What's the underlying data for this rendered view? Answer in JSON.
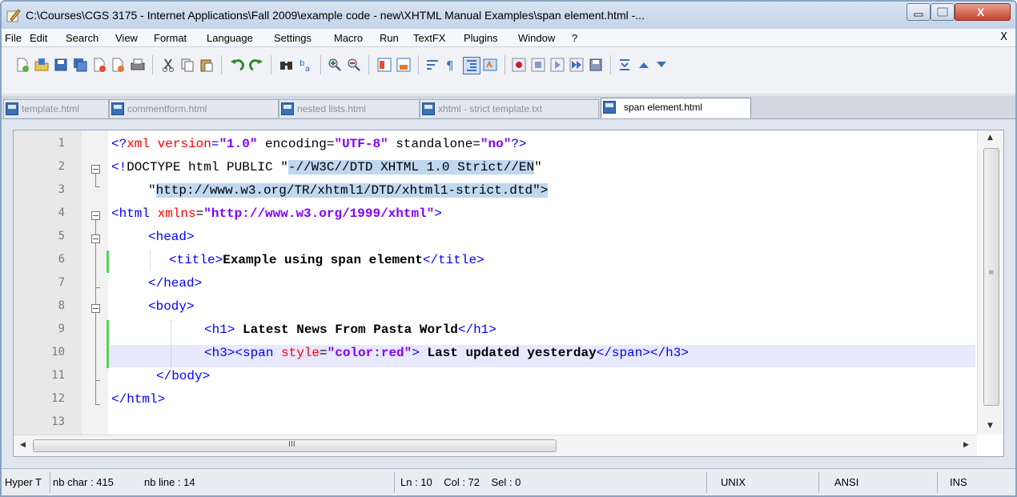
{
  "window": {
    "title": "C:\\Courses\\CGS 3175 - Internet Applications\\Fall 2009\\example code - new\\XHTML Manual Examples\\span element.html -...",
    "close_label": "X"
  },
  "menu": {
    "items": [
      "File",
      "Edit",
      "Search",
      "View",
      "Format",
      "Language",
      "Settings",
      "Macro",
      "Run",
      "TextFX",
      "Plugins",
      "Window",
      "?"
    ],
    "close_doc": "X"
  },
  "toolbar": {
    "icons": [
      "new-file-icon",
      "open-file-icon",
      "save-icon",
      "save-all-icon",
      "close-icon",
      "close-all-icon",
      "print-icon",
      "cut-icon",
      "copy-icon",
      "paste-icon",
      "undo-icon",
      "redo-icon",
      "find-icon",
      "replace-icon",
      "zoom-in-icon",
      "zoom-out-icon",
      "sync-vertical-icon",
      "sync-horizontal-icon",
      "word-wrap-icon",
      "show-all-chars-icon",
      "indent-guide-icon",
      "user-lang-icon",
      "record-macro-icon",
      "stop-macro-icon",
      "play-macro-icon",
      "run-macro-multiple-icon",
      "save-macro-icon",
      "collapse-icon",
      "move-up-icon",
      "move-down-icon"
    ]
  },
  "tabs": [
    {
      "label": "template.html",
      "active": false
    },
    {
      "label": "commentform.html",
      "active": false
    },
    {
      "label": "nested lists.html",
      "active": false
    },
    {
      "label": "xhtml - strict template.txt",
      "active": false
    },
    {
      "label": "span element.html",
      "active": true
    }
  ],
  "editor": {
    "line_numbers": [
      "1",
      "2",
      "3",
      "4",
      "5",
      "6",
      "7",
      "8",
      "9",
      "10",
      "11",
      "12",
      "13"
    ],
    "lines": {
      "l1": {
        "a": "<?",
        "b": "xml",
        "c": " version",
        "d": "=",
        "e": "\"1.0\"",
        "f": " encoding=",
        "g": "\"UTF-8\"",
        "h": " standalone=",
        "i": "\"no\"",
        "j": "?>"
      },
      "l2": {
        "a": "<!",
        "b": "DOCTYPE html PUBLIC ",
        "c": "\"",
        "d": "-//W3C//DTD XHTML 1.0 Strict//EN",
        "e": "\""
      },
      "l3": {
        "a": "\"",
        "b": "http://www.w3.org/TR/xhtml1/DTD/xhtml1-strict.dtd",
        "c": "\">"
      },
      "l4": {
        "a": "<html ",
        "b": "xmlns",
        "c": "=",
        "d": "\"http://www.w3.org/1999/xhtml\"",
        "e": ">"
      },
      "l5": {
        "a": "<head>"
      },
      "l6": {
        "a": "<title>",
        "b": "Example using span element",
        "c": "</title>"
      },
      "l7": {
        "a": "</head>"
      },
      "l8": {
        "a": "<body>"
      },
      "l9": {
        "a": "<h1>",
        "b": " Latest News From Pasta World",
        "c": "</h1>"
      },
      "l10": {
        "a": "<h3><span ",
        "b": "style",
        "c": "=",
        "d": "\"color:red\"",
        "e": ">",
        "f": " Last updated yesterday",
        "g": "</span></h3>"
      },
      "l11": {
        "a": "</body>"
      },
      "l12": {
        "a": "</html>"
      }
    },
    "hscroll_grip": "III"
  },
  "status": {
    "type": "Hyper T",
    "chars": "nb char : 415",
    "lines": "nb line : 14",
    "position": "Ln : 10    Col : 72    Sel : 0",
    "eol": "UNIX",
    "encoding": "ANSI",
    "mode": "INS"
  }
}
